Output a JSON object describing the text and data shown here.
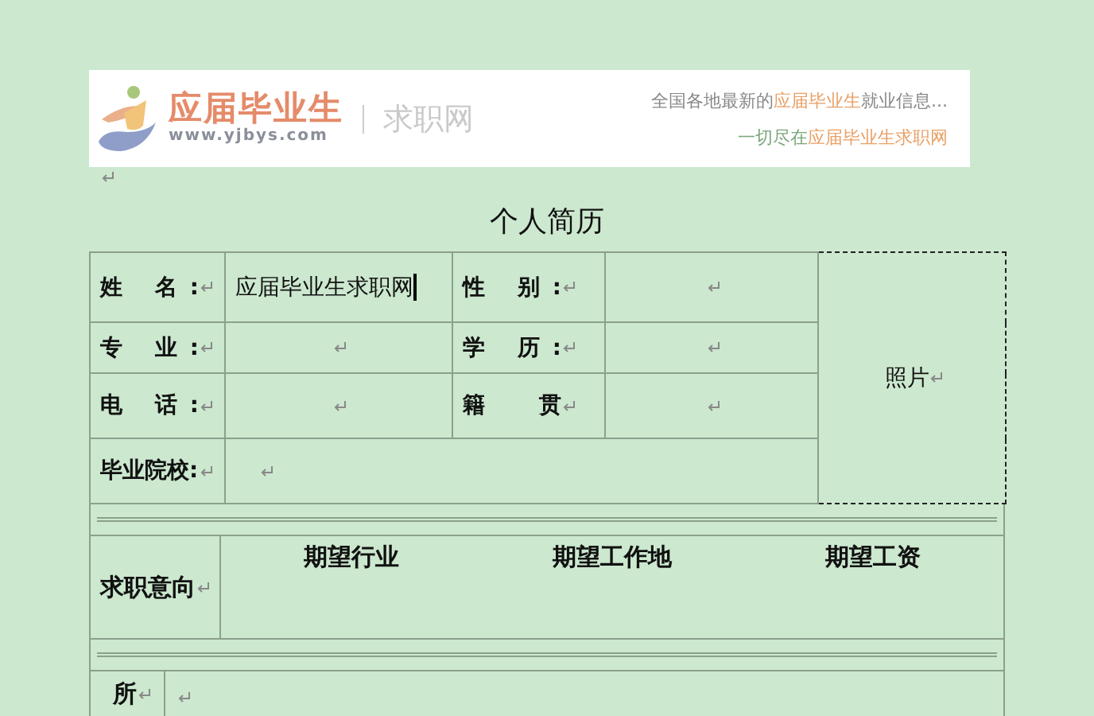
{
  "banner": {
    "brand": "应届毕业生",
    "url": "www.yjbys.com",
    "section": "求职网",
    "tagline": [
      {
        "text": "全国各地最新的",
        "highlight": false
      },
      {
        "text": "应届毕业生",
        "highlight": true
      },
      {
        "text": "就业信息...",
        "highlight": false
      }
    ],
    "slogan": [
      {
        "text": "一切尽在",
        "highlight": false
      },
      {
        "text": "应届毕业生求职网",
        "highlight": true
      }
    ]
  },
  "title": "个人简历",
  "info_rows": [
    {
      "label": "姓 名:",
      "value": "应届毕业生求职网",
      "cursor": true,
      "label_2": "性 别:"
    },
    {
      "label": "专 业:",
      "cursor": false,
      "label_2": "学 历:"
    },
    {
      "label": "电 话:",
      "cursor": false,
      "label_2": "籍 贯"
    }
  ],
  "photo": "照片",
  "school_label": "毕业院校:",
  "intention": {
    "label": "求职意向",
    "columns": [
      "期望行业",
      "期望工作地",
      "期望工资"
    ]
  },
  "next_label": "所"
}
